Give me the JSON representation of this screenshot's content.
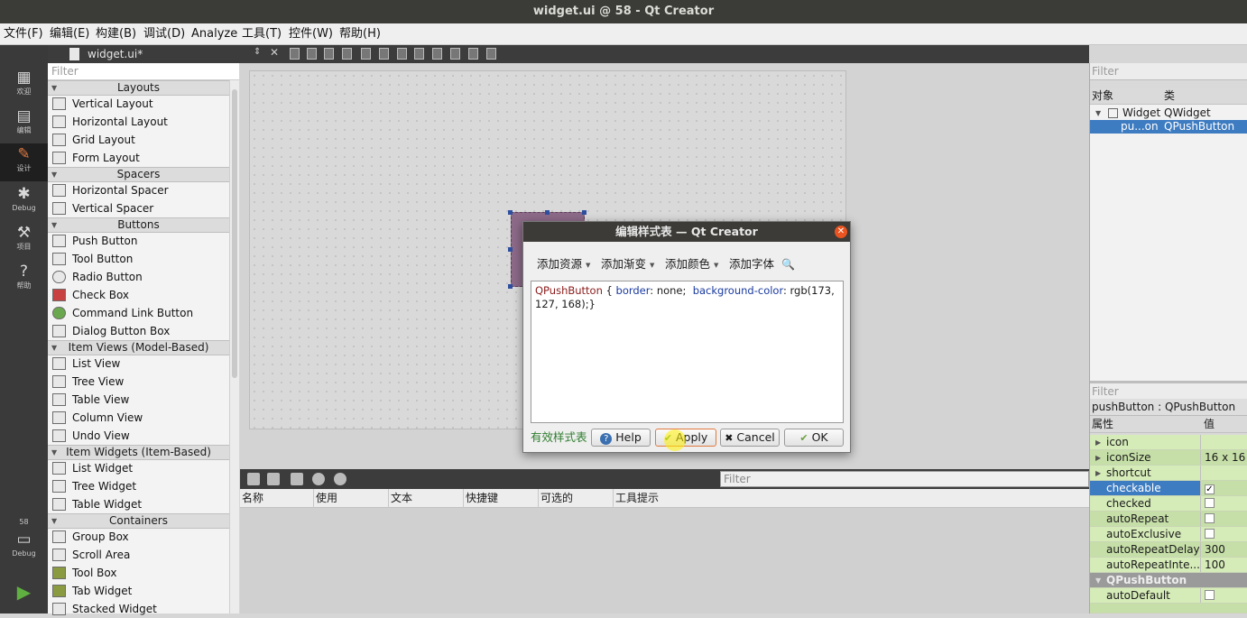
{
  "window": {
    "title": "widget.ui @ 58 - Qt Creator"
  },
  "menubar": [
    "文件(F)",
    "编辑(E)",
    "构建(B)",
    "调试(D)",
    "Analyze",
    "工具(T)",
    "控件(W)",
    "帮助(H)"
  ],
  "modes": [
    {
      "label": "欢迎",
      "icon": "grid-icon"
    },
    {
      "label": "编辑",
      "icon": "edit-icon"
    },
    {
      "label": "设计",
      "icon": "pen-icon"
    },
    {
      "label": "Debug",
      "icon": "bug-icon"
    },
    {
      "label": "项目",
      "icon": "wrench-icon"
    },
    {
      "label": "帮助",
      "icon": "help-icon"
    }
  ],
  "kit": {
    "number": "58",
    "label": "Debug"
  },
  "editor_tab": {
    "name": "widget.ui*"
  },
  "widgetbox": {
    "filter_placeholder": "Filter",
    "categories": [
      {
        "name": "Layouts",
        "items": [
          "Vertical Layout",
          "Horizontal Layout",
          "Grid Layout",
          "Form Layout"
        ]
      },
      {
        "name": "Spacers",
        "items": [
          "Horizontal Spacer",
          "Vertical Spacer"
        ]
      },
      {
        "name": "Buttons",
        "items": [
          "Push Button",
          "Tool Button",
          "Radio Button",
          "Check Box",
          "Command Link Button",
          "Dialog Button Box"
        ]
      },
      {
        "name": "Item Views (Model-Based)",
        "items": [
          "List View",
          "Tree View",
          "Table View",
          "Column View",
          "Undo View"
        ]
      },
      {
        "name": "Item Widgets (Item-Based)",
        "items": [
          "List Widget",
          "Tree Widget",
          "Table Widget"
        ]
      },
      {
        "name": "Containers",
        "items": [
          "Group Box",
          "Scroll Area",
          "Tool Box",
          "Tab Widget",
          "Stacked Widget"
        ]
      }
    ]
  },
  "action_editor": {
    "filter_placeholder": "Filter",
    "columns": [
      "名称",
      "使用",
      "文本",
      "快捷键",
      "可选的",
      "工具提示"
    ]
  },
  "object_inspector": {
    "filter_placeholder": "Filter",
    "headers": [
      "对象",
      "类"
    ],
    "rows": [
      {
        "object": "Widget",
        "class": "QWidget"
      },
      {
        "object": "pu...on",
        "class": "QPushButton"
      }
    ]
  },
  "property_editor": {
    "filter_placeholder": "Filter",
    "subject": "pushButton : QPushButton",
    "headers": [
      "属性",
      "值"
    ],
    "rows": [
      {
        "name": "icon",
        "value": ""
      },
      {
        "name": "iconSize",
        "value": "16 x 16"
      },
      {
        "name": "shortcut",
        "value": ""
      },
      {
        "name": "checkable",
        "value": "✓"
      },
      {
        "name": "checked",
        "value": ""
      },
      {
        "name": "autoRepeat",
        "value": ""
      },
      {
        "name": "autoExclusive",
        "value": ""
      },
      {
        "name": "autoRepeatDelay",
        "value": "300"
      },
      {
        "name": "autoRepeatInte...",
        "value": "100"
      },
      {
        "name": "QPushButton",
        "value": ""
      },
      {
        "name": "autoDefault",
        "value": ""
      }
    ]
  },
  "stylesheet_dialog": {
    "title": "编辑样式表 — Qt Creator",
    "menus": [
      "添加资源",
      "添加渐变",
      "添加颜色",
      "添加字体"
    ],
    "code": {
      "selector": "QPushButton",
      "p1": "border",
      "v1": "none;",
      "p2": "background-color",
      "v2": "rgb(173,",
      "line2": "127, 168);}"
    },
    "status": "有效样式表",
    "buttons": {
      "help": "Help",
      "apply": "Apply",
      "cancel": "Cancel",
      "ok": "OK"
    }
  },
  "colors": {
    "button_fill": "#ad7fa8",
    "selection": "#3e7cc1",
    "accent": "#e95420"
  }
}
